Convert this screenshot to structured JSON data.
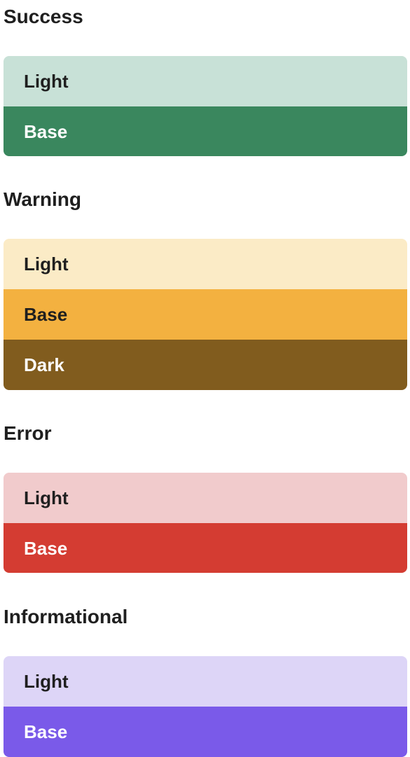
{
  "groups": [
    {
      "title": "Success",
      "swatches": [
        {
          "label": "Light",
          "color": "#c8e1d7"
        },
        {
          "label": "Base",
          "color": "#3a875e"
        }
      ]
    },
    {
      "title": "Warning",
      "swatches": [
        {
          "label": "Light",
          "color": "#fbebc6"
        },
        {
          "label": "Base",
          "color": "#f3b140"
        },
        {
          "label": "Dark",
          "color": "#815c1e"
        }
      ]
    },
    {
      "title": "Error",
      "swatches": [
        {
          "label": "Light",
          "color": "#f1cbcc"
        },
        {
          "label": "Base",
          "color": "#d43c32"
        }
      ]
    },
    {
      "title": "Informational",
      "swatches": [
        {
          "label": "Light",
          "color": "#ddd5f7"
        },
        {
          "label": "Base",
          "color": "#7a5ae9"
        }
      ]
    }
  ]
}
